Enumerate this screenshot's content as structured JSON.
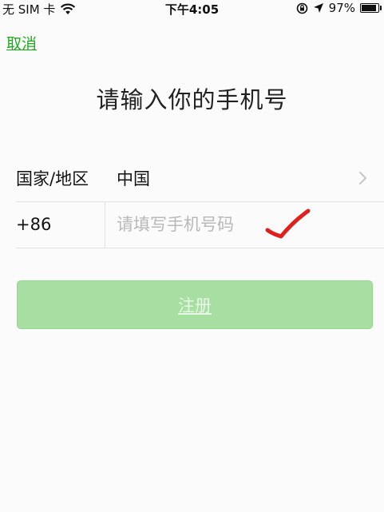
{
  "status_bar": {
    "carrier": "无 SIM 卡",
    "time": "下午4:05",
    "battery": "97%",
    "battery_level": 0.97
  },
  "nav": {
    "cancel_label": "取消"
  },
  "page": {
    "title": "请输入你的手机号"
  },
  "form": {
    "region_label": "国家/地区",
    "region_value": "中国",
    "country_code": "+86",
    "phone_placeholder": "请填写手机号码",
    "phone_value": ""
  },
  "register_button": {
    "label": "注册"
  },
  "colors": {
    "accent": "#1aad19",
    "button_disabled": "#a6dfa1",
    "checkmark": "#e0201a"
  },
  "icons": [
    "wifi-icon",
    "orientation-lock-icon",
    "location-arrow-icon",
    "battery-icon",
    "chevron-right-icon",
    "checkmark-annotation"
  ]
}
